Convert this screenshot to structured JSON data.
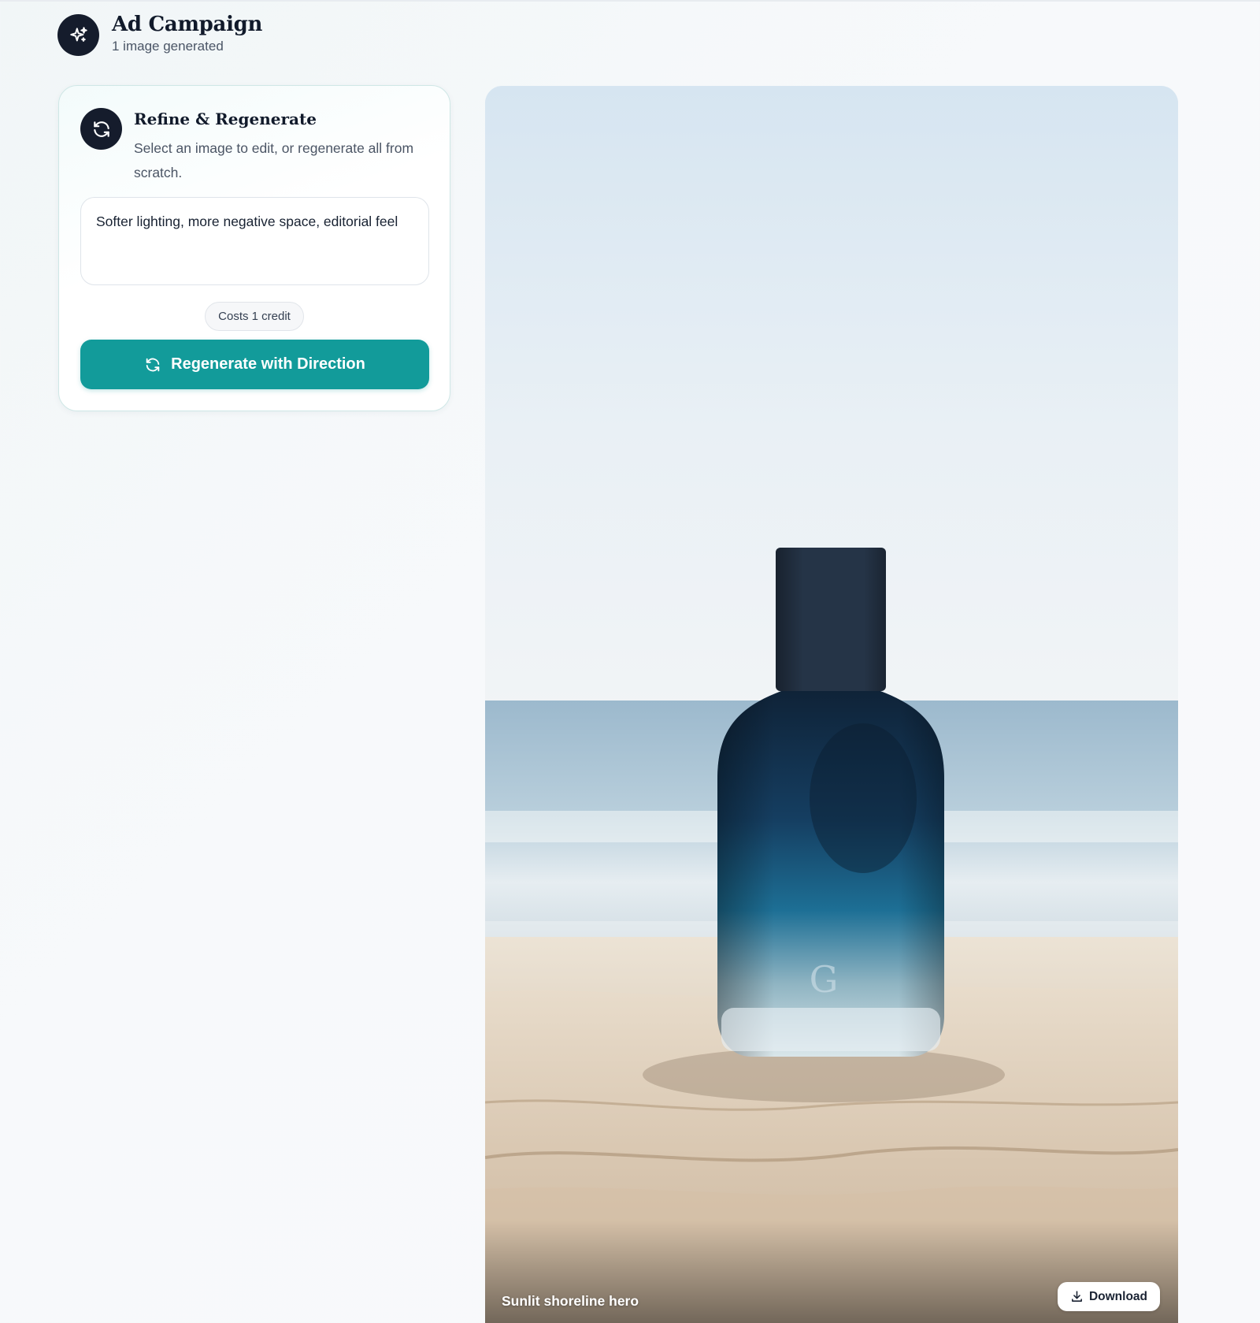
{
  "header": {
    "title": "Ad Campaign",
    "subtitle": "1 image generated",
    "icon": "sparkles-icon"
  },
  "refine_panel": {
    "title": "Refine & Regenerate",
    "description": "Select an image to edit, or regenerate all from scratch.",
    "icon": "refresh-icon",
    "prompt_value": "Softer lighting, more negative space, editorial feel",
    "cost_label": "Costs 1 credit",
    "button_label": "Regenerate with Direction",
    "button_color": "#129b9a"
  },
  "image_card": {
    "caption": "Sunlit shoreline hero",
    "download_label": "Download",
    "download_icon": "download-icon"
  }
}
